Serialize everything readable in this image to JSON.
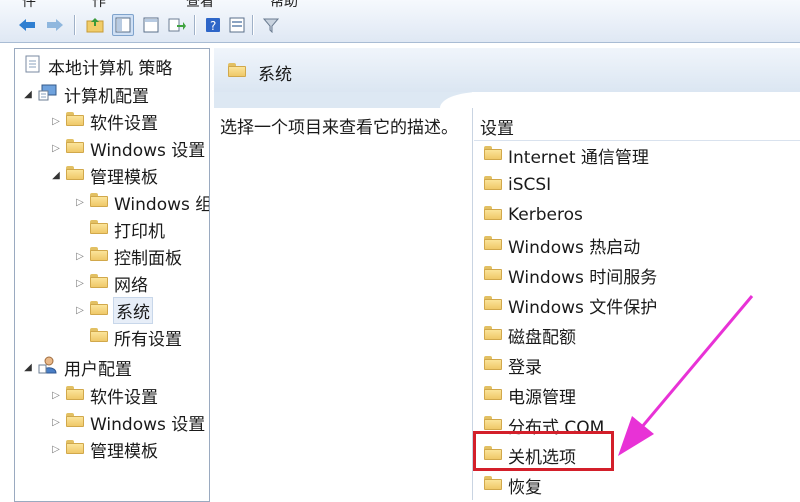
{
  "menu": {
    "items": [
      "件",
      "作",
      "查看",
      "帮助"
    ]
  },
  "toolbar": {
    "buttons": [
      "back-icon",
      "forward-icon",
      "up-folder-icon",
      "show-hide-tree-icon",
      "export-list-icon",
      "help-icon",
      "properties-icon",
      "filter-icon"
    ]
  },
  "tree": {
    "root": "本地计算机 策略",
    "computer_config": "计算机配置",
    "software_settings": "软件设置",
    "windows_settings": "Windows 设置",
    "admin_templates": "管理模板",
    "windows_components": "Windows 组件",
    "printers": "打印机",
    "control_panel": "控制面板",
    "network": "网络",
    "system": "系统",
    "all_settings": "所有设置",
    "user_config": "用户配置",
    "user_software_settings": "软件设置",
    "user_windows_settings": "Windows 设置",
    "user_admin_templates": "管理模板"
  },
  "right": {
    "title": "系统",
    "description": "选择一个项目来查看它的描述。",
    "list_header": "设置",
    "items": [
      "Internet 通信管理",
      "iSCSI",
      "Kerberos",
      "Windows 热启动",
      "Windows 时间服务",
      "Windows 文件保护",
      "磁盘配额",
      "登录",
      "电源管理",
      "分布式 COM",
      "关机选项",
      "恢复"
    ]
  },
  "annotation": {
    "highlight_color": "#d31f2a",
    "arrow_color": "#e832d6"
  }
}
